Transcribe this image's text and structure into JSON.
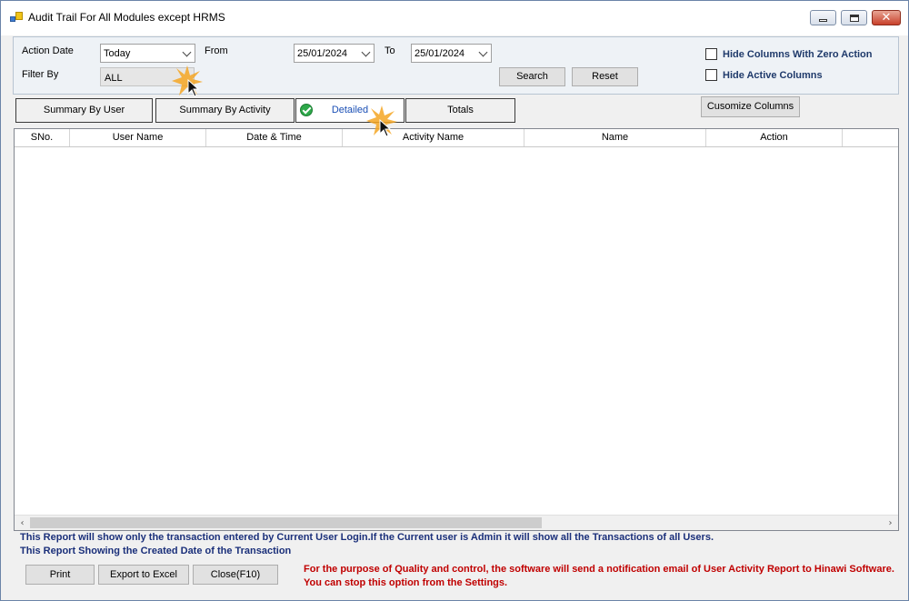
{
  "window": {
    "title": "Audit Trail For All Modules except HRMS"
  },
  "filters": {
    "action_date_label": "Action Date",
    "action_date_value": "Today",
    "from_label": "From",
    "from_value": "25/01/2024",
    "to_label": "To",
    "to_value": "25/01/2024",
    "filter_by_label": "Filter By",
    "filter_by_value": "ALL",
    "search_label": "Search",
    "reset_label": "Reset",
    "hide_zero_label": "Hide Columns With Zero Action",
    "hide_active_label": "Hide Active Columns"
  },
  "tabs": [
    {
      "label": "Summary By User"
    },
    {
      "label": "Summary By Activity"
    },
    {
      "label": "Detailed",
      "selected": true
    },
    {
      "label": "Totals"
    }
  ],
  "customize_label": "Cusomize Columns",
  "grid": {
    "columns": [
      "SNo.",
      "User Name",
      "Date & Time",
      "Activity Name",
      "Name",
      "Action"
    ],
    "rows": []
  },
  "info": {
    "line1": "This Report will show only the transaction entered by Current User Login.If the Current user is Admin it will show all the Transactions of all Users.",
    "line2": "This Report Showing the Created Date of the Transaction"
  },
  "footer": {
    "print_label": "Print",
    "export_label": "Export to Excel",
    "close_label": "Close(F10)",
    "notice": "For the purpose of Quality and control, the software  will send a notification email of User Activity Report to Hinawi Software. You can stop  this option from the Settings."
  },
  "colors": {
    "info_text": "#1a2f7a",
    "notice_text": "#c00000",
    "selected_tab_text": "#1a4fb5",
    "check_green": "#2ea84a"
  }
}
